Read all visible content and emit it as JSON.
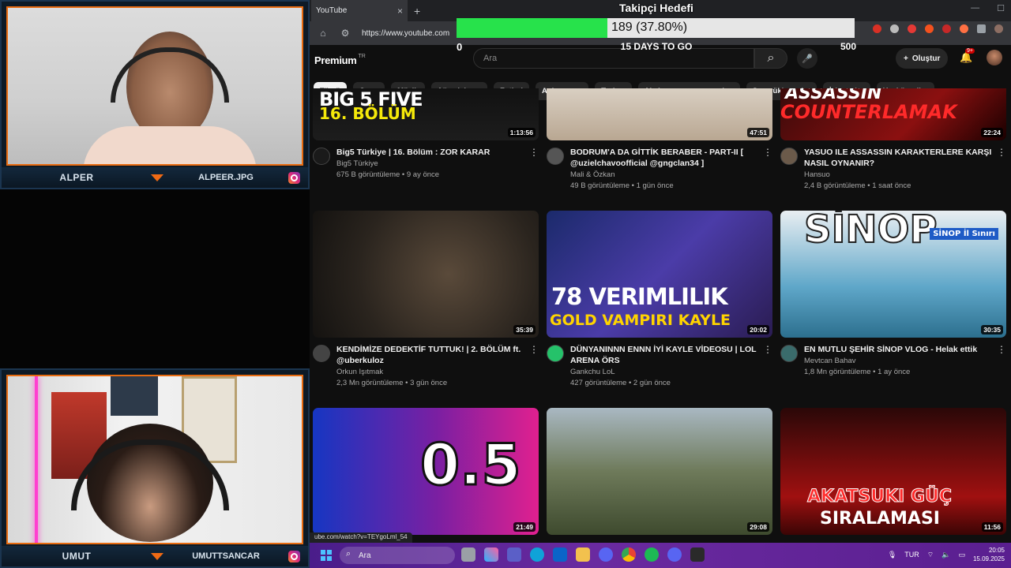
{
  "cams": {
    "top": {
      "name": "ALPER",
      "handle": "ALPEER.JPG"
    },
    "bottom": {
      "name": "UMUT",
      "handle": "UMUTTSANCAR"
    }
  },
  "browser": {
    "tab_title": "YouTube",
    "url": "https://www.youtube.com",
    "status_url": "ube.com/watch?v=TEYgoLml_54"
  },
  "youtube": {
    "logo": "Premium",
    "logo_sup": "TR",
    "search_placeholder": "Ara",
    "create_label": "Oluştur",
    "notif_count": "9+",
    "chips": [
      "Tümü",
      "Oyun",
      "Müzik",
      "Ağaç işleme",
      "Futbol",
      "Animasyon",
      "Turizm",
      "Aksiyon-macera oyunları",
      "Son yüklenenler",
      "İzlenenler",
      "Yeni öneriler"
    ],
    "videos": [
      {
        "title": "Big5 Türkiye | 16. Bölüm : ZOR KARAR",
        "channel": "Big5 Türkiye",
        "stats": "675 B görüntüleme • 9 ay önce",
        "duration": "1:13:56",
        "thumb_text_1": "BIG 5 FIVE",
        "thumb_text_2": "16. BÖLÜM"
      },
      {
        "title": "BODRUM'A DA GİTTİK BERABER - PART-II [ @uzielchavoofficial @gngclan34 ]",
        "channel": "Mali & Özkan",
        "stats": "49 B görüntüleme • 1 gün önce",
        "duration": "47:51",
        "thumb_text_1": "",
        "thumb_text_2": ""
      },
      {
        "title": "YASUO ILE ASSASSIN KARAKTERLERE KARŞI NASIL OYNANIR?",
        "channel": "Hansuo",
        "stats": "2,4 B görüntüleme • 1 saat önce",
        "duration": "22:24",
        "thumb_text_1": "ASSASSIN",
        "thumb_text_2": "COUNTERLAMAK"
      },
      {
        "title": "KENDİMİZE DEDEKTİF TUTTUK! | 2. BÖLÜM ft. @uberkuloz",
        "channel": "Orkun Işıtmak",
        "stats": "2,3 Mn görüntüleme • 3 gün önce",
        "duration": "35:39",
        "thumb_text_1": "",
        "thumb_text_2": ""
      },
      {
        "title": "DÜNYANINNN ENNN İYİ KAYLE VİDEOSU | LOL ARENA ÖRS",
        "channel": "Gankchu LoL",
        "stats": "427 görüntüleme • 2 gün önce",
        "duration": "20:02",
        "thumb_text_1": "78 VERIMLILIK",
        "thumb_text_2": "GOLD VAMPIRI KAYLE"
      },
      {
        "title": "EN MUTLU ŞEHİR SİNOP VLOG - Helak ettik",
        "channel": "Mevtcan Bahav",
        "stats": "1,8 Mn görüntüleme • 1 ay önce",
        "duration": "30:35",
        "thumb_text_1": "SİNOP",
        "thumb_text_2": "SİNOP İl Sınırı"
      },
      {
        "title": "",
        "channel": "",
        "stats": "",
        "duration": "21:49",
        "thumb_text_1": "0.5",
        "thumb_text_2": ""
      },
      {
        "title": "",
        "channel": "",
        "stats": "",
        "duration": "29:08",
        "thumb_text_1": "",
        "thumb_text_2": ""
      },
      {
        "title": "",
        "channel": "",
        "stats": "",
        "duration": "11:56",
        "thumb_text_1": "AKATSUKI GÜÇ",
        "thumb_text_2": "SIRALAMASI"
      }
    ]
  },
  "goal": {
    "title": "Takipçi Hedefi",
    "current_label": "189 (37.80%)",
    "fraction": 0.378,
    "min": "0",
    "max": "500",
    "days_left": "15 DAYS TO GO"
  },
  "taskbar": {
    "search_placeholder": "Ara",
    "lang": "TUR",
    "time": "20:05",
    "date": "15.09.2025"
  },
  "colors": {
    "goal_fill": "#27e24b",
    "cam_border": "#e86b10",
    "yt_badge": "#cc0000"
  }
}
